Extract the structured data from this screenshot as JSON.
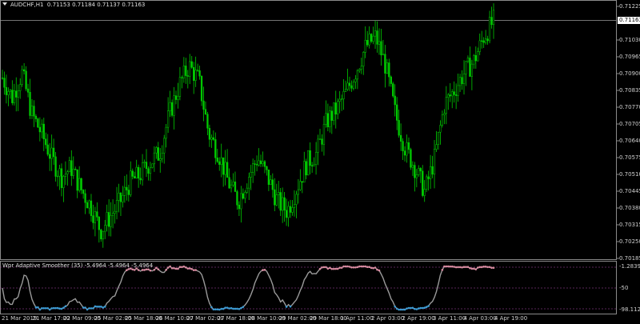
{
  "header": {
    "symbol_tf": "AUDCHF,H1",
    "ohlc": "0.71153 0.71184 0.71137 0.71163"
  },
  "current_price": "0.71163",
  "price_axis": [
    "0.71225",
    "0.71095",
    "0.71030",
    "0.70965",
    "0.70900",
    "0.70835",
    "0.70770",
    "0.70705",
    "0.70640",
    "0.70575",
    "0.70510",
    "0.70445",
    "0.70380",
    "0.70315",
    "0.70250",
    "0.70185"
  ],
  "indicator": {
    "title": "Wpr Adaptive Smoother (35) -5.4964 -5.4964 -5.4964",
    "axis": [
      "-1.2839",
      "-50",
      "-98.1127"
    ],
    "levels": [
      "-10",
      "-50",
      "-90"
    ]
  },
  "time_axis": [
    "21 Mar 2019",
    "21 Mar 17:00",
    "22 Mar 09:00",
    "25 Mar 02:00",
    "25 Mar 18:00",
    "26 Mar 10:00",
    "27 Mar 02:00",
    "27 Mar 18:00",
    "28 Mar 10:00",
    "29 Mar 02:00",
    "29 Mar 18:00",
    "1 Apr 11:00",
    "2 Apr 03:00",
    "2 Apr 19:00",
    "3 Apr 11:00",
    "4 Apr 03:00",
    "4 Apr 19:00"
  ],
  "colors": {
    "background": "#000000",
    "candles": "#00cc00",
    "grid_border": "#8a8a8a",
    "indicator_line": "#9a9a9a",
    "indicator_up": "#d98aa0",
    "indicator_down": "#3a9bd5",
    "level_line": "#b04cb0"
  },
  "chart_data": {
    "type": "line",
    "title": "AUDCHF,H1",
    "ylim": [
      0.70185,
      0.71225
    ],
    "close_path_anchors": [
      [
        0.7093
      ],
      [
        0.7085
      ],
      [
        0.7095
      ],
      [
        0.7078
      ],
      [
        0.707
      ],
      [
        0.706
      ],
      [
        0.7052
      ],
      [
        0.7056
      ],
      [
        0.7047
      ],
      [
        0.704
      ],
      [
        0.703
      ],
      [
        0.7036
      ],
      [
        0.7042
      ],
      [
        0.705
      ],
      [
        0.7053
      ],
      [
        0.7058
      ],
      [
        0.7062
      ],
      [
        0.7078
      ],
      [
        0.709
      ],
      [
        0.7098
      ],
      [
        0.7092
      ],
      [
        0.707
      ],
      [
        0.7062
      ],
      [
        0.705
      ],
      [
        0.7042
      ],
      [
        0.7052
      ],
      [
        0.706
      ],
      [
        0.7052
      ],
      [
        0.7042
      ],
      [
        0.7038
      ],
      [
        0.7048
      ],
      [
        0.7058
      ],
      [
        0.7062
      ],
      [
        0.7075
      ],
      [
        0.708
      ],
      [
        0.7087
      ],
      [
        0.7096
      ],
      [
        0.7106
      ],
      [
        0.711
      ],
      [
        0.7098
      ],
      [
        0.7078
      ],
      [
        0.7064
      ],
      [
        0.7056
      ],
      [
        0.7046
      ],
      [
        0.706
      ],
      [
        0.7082
      ],
      [
        0.7088
      ],
      [
        0.7095
      ],
      [
        0.71
      ],
      [
        0.711
      ],
      [
        0.71165
      ]
    ]
  }
}
